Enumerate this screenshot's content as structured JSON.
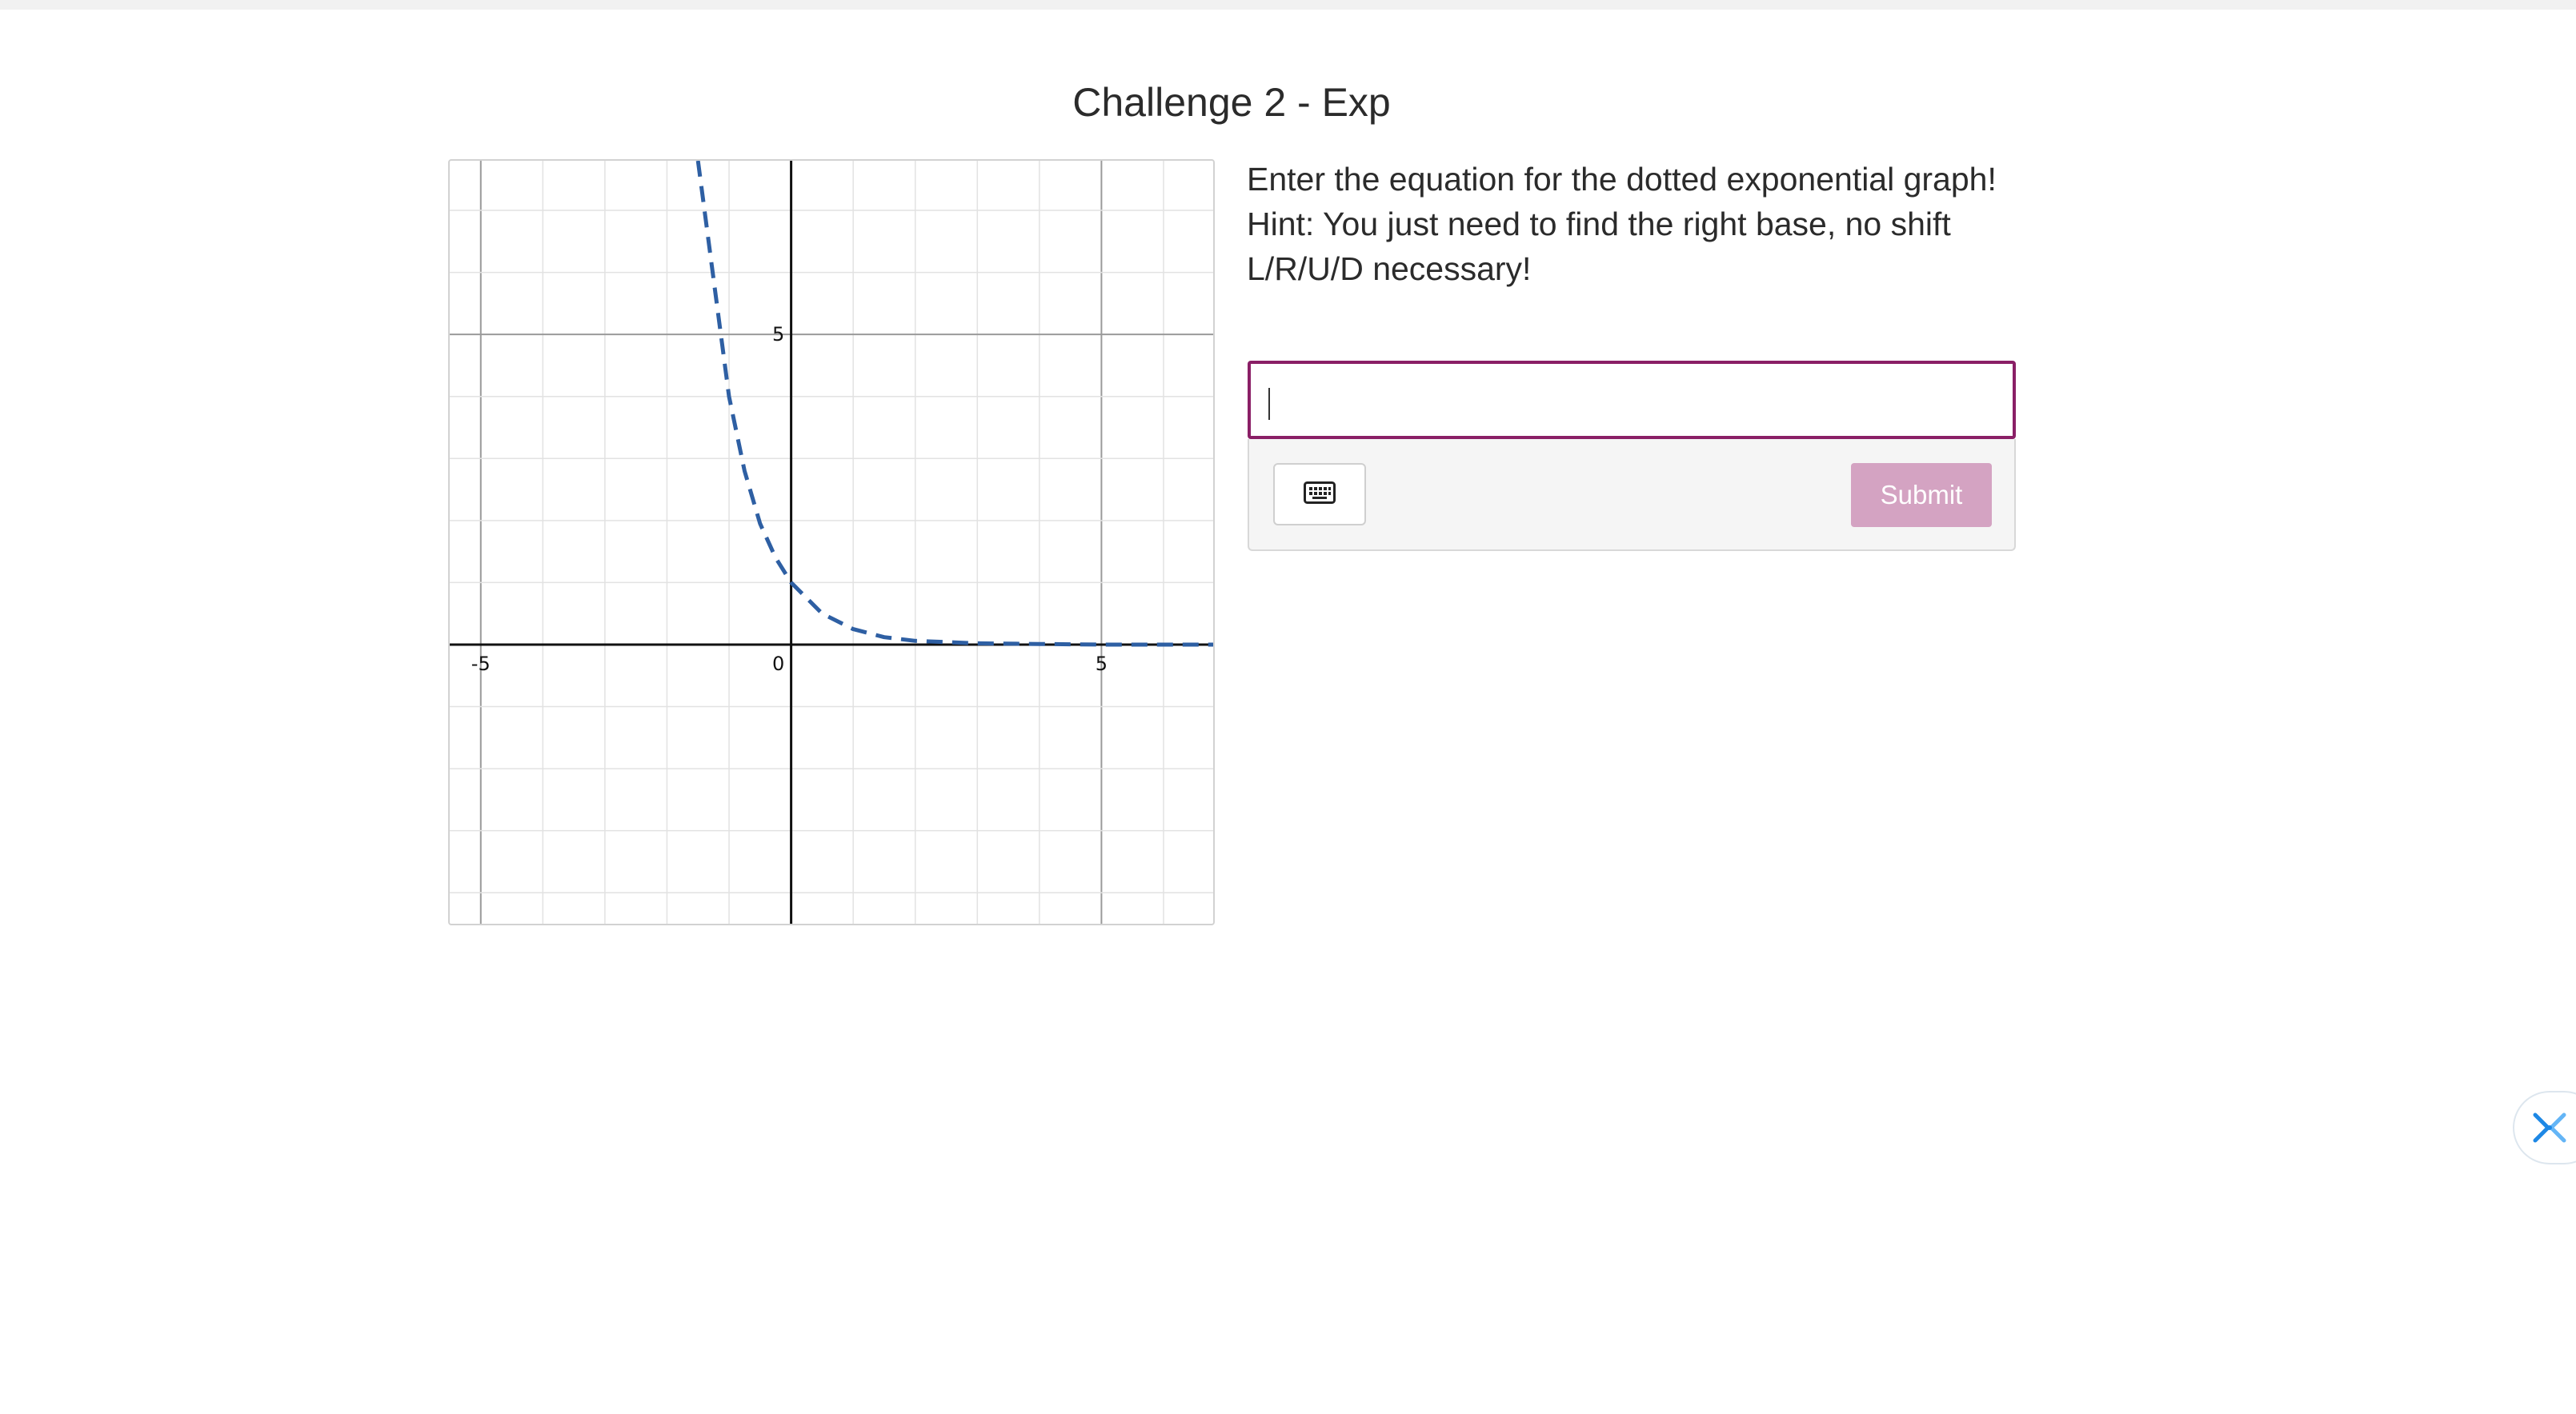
{
  "page": {
    "title": "Challenge 2 - Exp"
  },
  "instructions": {
    "line1": "Enter the equation for the dotted exponential graph!",
    "line2": "Hint: You just need to find the right base, no shift L/R/U/D necessary!"
  },
  "answer": {
    "value": "",
    "placeholder": ""
  },
  "toolbar": {
    "keyboard_icon": "keyboard-icon",
    "submit_label": "Submit"
  },
  "floating_widget": {
    "icon": "scissors-icon"
  },
  "colors": {
    "accent": "#8a1f66",
    "submit_disabled": "#d4a3c2",
    "curve": "#2e5fa3",
    "widget_icon": "#1e88e5"
  },
  "chart_data": {
    "type": "line",
    "xlim": [
      -5.5,
      6.8
    ],
    "ylim": [
      -4.5,
      7.8
    ],
    "grid": true,
    "x_ticks": [
      "-5",
      "0",
      "5"
    ],
    "y_ticks": [
      "5"
    ],
    "series": [
      {
        "style": "dashed",
        "x": [
          -1.5,
          -1.25,
          -1.0,
          -0.75,
          -0.5,
          -0.25,
          0,
          0.5,
          1.0,
          1.5,
          2.0,
          3.0,
          4.0,
          5.0,
          6.8
        ],
        "y": [
          7.8,
          5.9,
          4.0,
          2.8,
          1.95,
          1.4,
          1.0,
          0.5,
          0.25,
          0.12,
          0.06,
          0.02,
          0.01,
          0.0,
          0.0
        ]
      }
    ]
  }
}
